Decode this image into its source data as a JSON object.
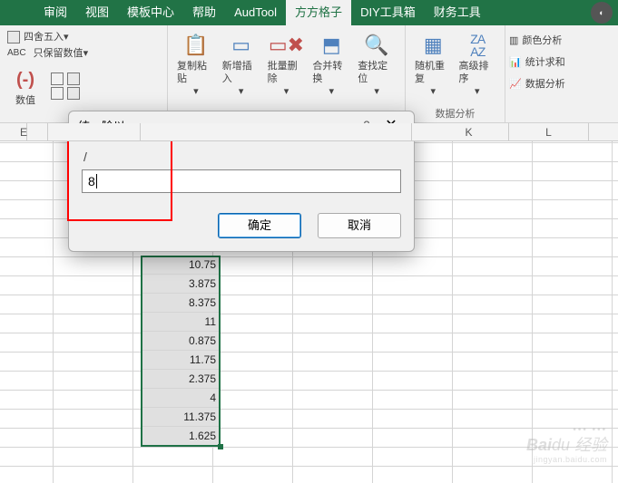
{
  "tabs": {
    "review": "审阅",
    "view": "视图",
    "template_center": "模板中心",
    "help": "帮助",
    "audtool": "AudTool",
    "fanggezi": "方方格子",
    "diy_toolbox": "DIY工具箱",
    "finance_tools": "财务工具"
  },
  "ribbon": {
    "sishewuru": "四舍五入",
    "baoliu_shuzhi": "只保留数值",
    "shuzhi": "数值",
    "fuzhi": "复制粘贴",
    "xinzeng": "新增插入",
    "piliang": "批量删除",
    "hebing": "合并转换",
    "chazhao": "查找定位",
    "suiji": "随机重复",
    "gaoji": "高级排序",
    "yanse": "颜色分析",
    "tongji": "统计求和",
    "shuju_fx": "数据分析",
    "shuju_fx_group": "数据分析"
  },
  "columns": [
    "E",
    "K",
    "L"
  ],
  "values": [
    "10.75",
    "3.875",
    "8.375",
    "11",
    "0.875",
    "11.75",
    "2.375",
    "4",
    "11.375",
    "1.625"
  ],
  "dialog": {
    "title": "统一除以",
    "slash": "/",
    "value": "8",
    "ok": "确定",
    "cancel": "取消",
    "help": "?",
    "close": "✕"
  },
  "watermark": {
    "main": "Baidu 经验",
    "sub": "jingyan.baidu.com"
  }
}
